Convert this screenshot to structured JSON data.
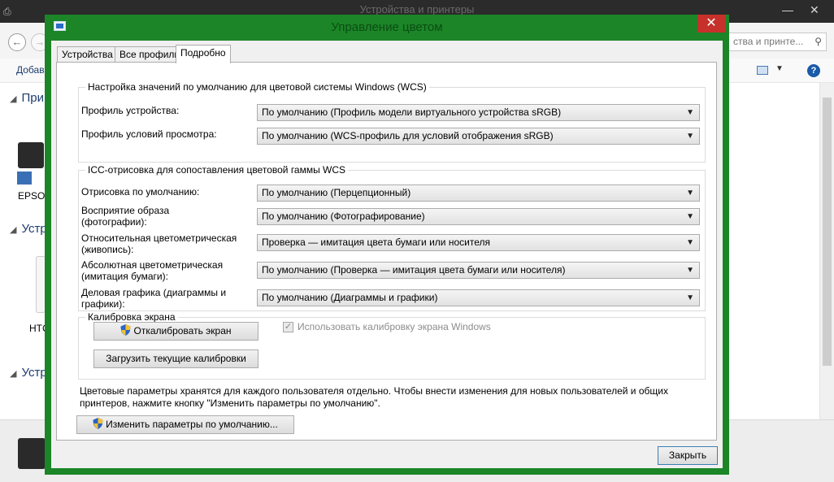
{
  "background_window": {
    "title": "Устройства и принтеры",
    "search_placeholder": "ства и принте...",
    "toolbar_add": "Добав",
    "groups": [
      "Прин",
      "Устр",
      "Устр"
    ],
    "devices": [
      "EPSON",
      "HTC"
    ]
  },
  "dialog": {
    "title": "Управление цветом",
    "close_glyph": "✕",
    "tabs": [
      {
        "label": "Устройства",
        "active": false
      },
      {
        "label": "Все профили",
        "active": false
      },
      {
        "label": "Подробно",
        "active": true
      }
    ],
    "wcs": {
      "legend": "Настройка значений по умолчанию для цветовой системы Windows (WCS)",
      "rows": [
        {
          "label": "Профиль устройства:",
          "value": "По умолчанию (Профиль модели виртуального устройства sRGB)"
        },
        {
          "label": "Профиль условий просмотра:",
          "value": "По умолчанию (WCS-профиль для условий отображения sRGB)"
        }
      ]
    },
    "icc": {
      "legend": "ICC-отрисовка для сопоставления цветовой гаммы WCS",
      "rows": [
        {
          "label": "Отрисовка по умолчанию:",
          "value": "По умолчанию (Перцепционный)"
        },
        {
          "label": "Восприятие образа\n(фотографии):",
          "value": "По умолчанию (Фотографирование)"
        },
        {
          "label": "Относительная цветометрическая\n(живопись):",
          "value": "Проверка — имитация цвета бумаги или носителя"
        },
        {
          "label": "Абсолютная цветометрическая\n(имитация бумаги):",
          "value": "По умолчанию (Проверка — имитация цвета бумаги или носителя)"
        },
        {
          "label": "Деловая графика (диаграммы и\nграфики):",
          "value": "По умолчанию (Диаграммы и графики)"
        }
      ]
    },
    "calibration": {
      "legend": "Калибровка экрана",
      "calibrate_button": "Откалибровать экран",
      "load_button": "Загрузить текущие калибровки",
      "use_windows_calibration_label": "Использовать калибровку экрана Windows",
      "use_windows_calibration_checked": true
    },
    "note": "Цветовые параметры хранятся для каждого пользователя отдельно. Чтобы внести изменения для новых пользователей и общих принтеров, нажмите кнопку \"Изменить параметры по умолчанию\".",
    "change_defaults_button": "Изменить параметры по умолчанию...",
    "close_button": "Закрыть"
  },
  "colors": {
    "dialog_frame": "#1c8527",
    "close_button_red": "#c7312b",
    "group_heading_blue": "#1e3c6e"
  }
}
